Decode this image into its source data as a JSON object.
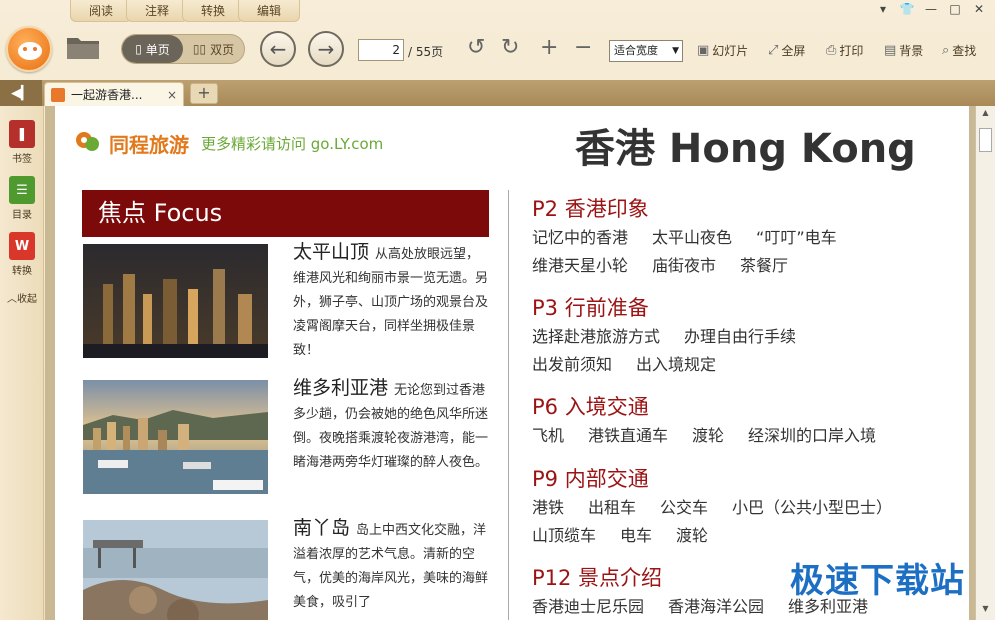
{
  "menu": {
    "tabs": [
      "阅读",
      "注释",
      "转换",
      "编辑"
    ]
  },
  "toolbar": {
    "view_single": "单页",
    "view_double": "双页",
    "page_current": "2",
    "page_total": "/ 55页",
    "zoom": "适合宽度",
    "slideshow": "幻灯片",
    "fullscreen": "全屏",
    "print": "打印",
    "background": "背景",
    "find": "查找"
  },
  "doctab": {
    "title": "一起游香港...",
    "close": "×",
    "add": "+"
  },
  "sidebar": {
    "bookmark": "书签",
    "toc": "目录",
    "convert": "转换",
    "collapse": "收起"
  },
  "page": {
    "brand_name": "同程旅游",
    "brand_sub": "更多精彩请访问 go.LY.com",
    "title": "香港 Hong Kong",
    "focus": "焦点  Focus",
    "items": [
      {
        "title": "太平山顶",
        "text": "从高处放眼远望，维港风光和绚丽市景一览无遗。另外，狮子亭、山顶广场的观景台及凌霄阁摩天台，同样坐拥极佳景致！"
      },
      {
        "title": "维多利亚港",
        "text": "无论您到过香港多少趟，仍会被她的绝色风华所迷倒。夜晚搭乘渡轮夜游港湾，能一睹海港两旁华灯璀璨的醉人夜色。"
      },
      {
        "title": "南丫岛",
        "text": "岛上中西文化交融，洋溢着浓厚的艺术气息。清新的空气，优美的海岸风光，美味的海鲜美食，吸引了"
      }
    ],
    "sections": [
      {
        "heading": "P2  香港印象",
        "rows": [
          [
            "记忆中的香港",
            "太平山夜色",
            "“叮叮”电车"
          ],
          [
            "维港天星小轮",
            "庙街夜市",
            "茶餐厅"
          ]
        ]
      },
      {
        "heading": "P3  行前准备",
        "rows": [
          [
            "选择赴港旅游方式",
            "办理自由行手续"
          ],
          [
            "出发前须知",
            "出入境规定"
          ]
        ]
      },
      {
        "heading": "P6  入境交通",
        "rows": [
          [
            "飞机",
            "港铁直通车",
            "渡轮",
            "经深圳的口岸入境"
          ]
        ]
      },
      {
        "heading": "P9 内部交通",
        "rows": [
          [
            "港铁",
            "出租车",
            "公交车",
            "小巴（公共小型巴士）"
          ],
          [
            "山顶缆车",
            "电车",
            "渡轮"
          ]
        ]
      },
      {
        "heading": "P12 景点介绍",
        "rows": [
          [
            "香港迪士尼乐园",
            "香港海洋公园",
            "维多利亚港"
          ]
        ]
      }
    ]
  },
  "watermark": "极速下载站"
}
